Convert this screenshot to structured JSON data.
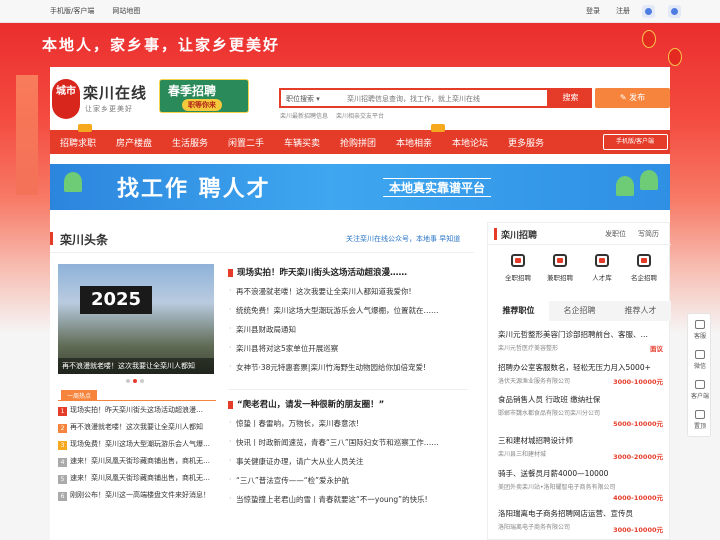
{
  "topbar": {
    "mobile_link": "手机版/客户端",
    "sitemap_link": "网站地图",
    "login": "登录",
    "register": "注册"
  },
  "banner": {
    "slogan": "本地人，家乡事，让家乡更美好"
  },
  "logo": {
    "circle_text": "城市",
    "name": "栾川在线",
    "sub": "让家乡更美好"
  },
  "recruit_badge": {
    "title": "春季招聘",
    "sub": "职等你来"
  },
  "search": {
    "select_label": "职位搜索",
    "placeholder": "栾川招聘信息查询，找工作，就上栾川在线",
    "button": "搜索",
    "publish": "发布",
    "hot_links": [
      "栾川最新招聘信息",
      "栾川相亲交友平台"
    ]
  },
  "nav": {
    "items": [
      "招聘求职",
      "房产楼盘",
      "生活服务",
      "闲置二手",
      "车辆买卖",
      "抢购拼团",
      "本地相亲",
      "本地论坛",
      "更多服务"
    ],
    "mobile_button": "手机版/客户端"
  },
  "ad": {
    "headline": "找工作 聘人才",
    "tagline": "本地真实靠谱平台"
  },
  "headlines": {
    "title": "栾川头条",
    "more": "关注栾川在线公众号，本地事 早知道",
    "photo_board": "2025",
    "photo_caption": "再不浪漫就老喽！这次我要让全栾川人都知",
    "hot_tab": "一周热点",
    "hot_list": [
      "现场实拍！昨天栾川街头这场活动超浪漫…",
      "再不浪漫就老喽！这次我要让全栾川人都知",
      "现场免费！栾川这场大型潮玩游乐会人气爆…",
      "速来！栾川凤凰天街珍藏商铺出售，商机无…",
      "速来！栾川凤凰天街珍藏商铺出售，商机无…",
      "刚刚公布！栾川这一高端楼盘文件来好消息！"
    ],
    "group1_head": "现场实拍！昨天栾川街头这场活动超浪漫……",
    "group1": [
      "再不浪漫就老喽！这次我要让全栾川人都知道我爱你!",
      "统统免费！栾川这场大型潮玩游乐会人气爆棚，位置就在……",
      "栾川县财政局通知",
      "栾川县将对这5家单位开展巡察",
      "女神节·38元特惠套票|栾川竹海野生动物园给你加倍宠爱!"
    ],
    "group2_head": "“爬老君山，请发一种很新的朋友圈！”",
    "group2": [
      "惊蛰丨春雷响，万物长，栾川春意浓!",
      "快讯丨时政新闻速览，青春“三八”国际妇女节和巡察工作……",
      "事关健康证办理，请广大从业人员关注",
      "“三八”普法宣传——“检”爱永护航",
      "当惊蛰撞上老君山的雪丨青春就要这“不一young”的快乐!"
    ]
  },
  "jobs": {
    "title": "栾川招聘",
    "links": [
      "发职位",
      "写简历"
    ],
    "icons": [
      "全职招聘",
      "兼职招聘",
      "人才库",
      "名企招聘"
    ],
    "tabs": [
      "推荐职位",
      "名企招聘",
      "推荐人才"
    ],
    "list": [
      {
        "title": "栾川元哲整形美容门诊部招聘前台、客服、…",
        "company": "栾川元哲医疗美容整形",
        "salary": "面议"
      },
      {
        "title": "招聘办公室客服数名，轻松无压力月入5000+",
        "company": "洛伏天源渔业服务有限公司",
        "salary": "3000-10000元"
      },
      {
        "title": "食品销售人员 行政班 缴纳社保",
        "company": "邯郸市魏水都食品有限公司栾川分公司",
        "salary": "5000-10000元"
      },
      {
        "title": "三和建材城招聘设计师",
        "company": "栾川县三和建材城",
        "salary": "3000-20000元"
      },
      {
        "title": "骑手、送餐员月薪4000—10000",
        "company": "美团外卖栾川站•洛阳耀智电子商务有限公司",
        "salary": "4000-10000元"
      },
      {
        "title": "洛阳瑞离电子商务招聘网店运营、宣传员",
        "company": "洛阳瑞离电子商务有限公司",
        "salary": "3000-10000元"
      }
    ]
  },
  "float": {
    "items": [
      "客服",
      "微信",
      "客户端",
      "置顶"
    ]
  },
  "colors": {
    "brand_red": "#e53c2a",
    "accent_orange": "#f6843c",
    "ad_blue": "#2c85dd"
  }
}
